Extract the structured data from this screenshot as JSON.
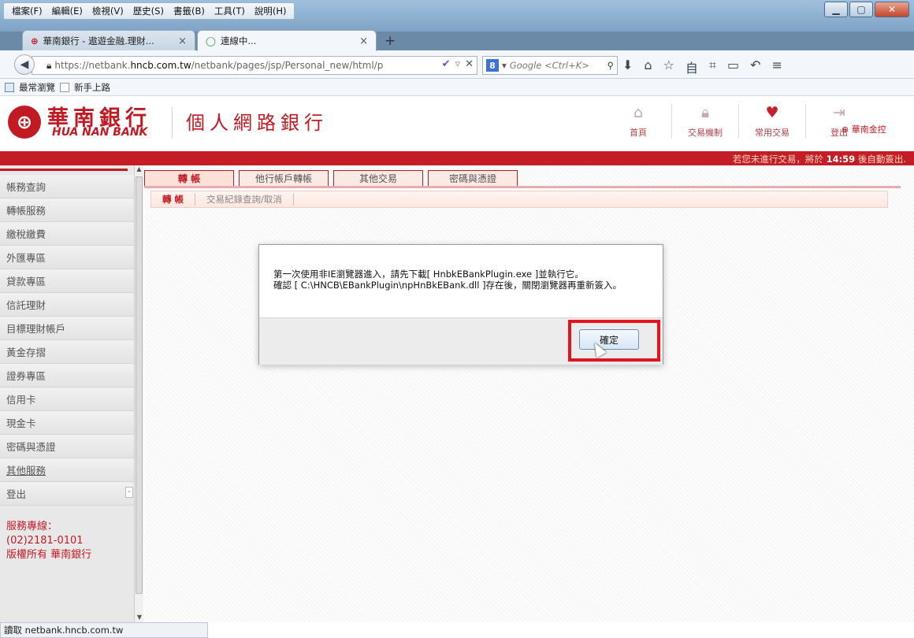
{
  "menu": [
    "檔案(F)",
    "編輯(E)",
    "檢視(V)",
    "歷史(S)",
    "書籤(B)",
    "工具(T)",
    "說明(H)"
  ],
  "tabs": [
    {
      "label": "華南銀行 - 遨遊金融.理財..."
    },
    {
      "label": "連線中..."
    }
  ],
  "url": {
    "prefix": "https://netbank.",
    "host": "hncb.com.tw",
    "rest": "/netbank/pages/jsp/Personal_new/html/p"
  },
  "search": {
    "placeholder": "Google <Ctrl+K>"
  },
  "bookmarks": [
    "最常瀏覽",
    "新手上路"
  ],
  "bank": {
    "logo_zh": "華南銀行",
    "logo_en": "HUA NAN BANK",
    "site_title": "個人網路銀行",
    "brand_small": "華南金控"
  },
  "topnav": [
    {
      "label": "首頁",
      "icon": "home-icon"
    },
    {
      "label": "交易機制",
      "icon": "lock-icon"
    },
    {
      "label": "常用交易",
      "icon": "heart-icon"
    },
    {
      "label": "登出",
      "icon": "logout-icon"
    }
  ],
  "notice": {
    "before": "若您未進行交易，將於 ",
    "time": "14:59",
    "after": " 後自動簽出."
  },
  "sidebar": {
    "items": [
      "帳務查詢",
      "轉帳服務",
      "繳稅繳費",
      "外匯專區",
      "貸款專區",
      "信託理財",
      "目標理財帳戶",
      "黃金存摺",
      "證券專區",
      "信用卡",
      "現金卡",
      "密碼與憑證",
      "其他服務",
      "登出"
    ],
    "footer": {
      "line1": "服務專線：",
      "line2": "(02)2181-0101",
      "line3": "版權所有 華南銀行"
    }
  },
  "content_tabs": [
    "轉 帳",
    "他行帳戶轉帳",
    "其他交易",
    "密碼與憑證"
  ],
  "sub_tabs": [
    "轉 帳",
    "交易紀錄查詢/取消"
  ],
  "dialog": {
    "line1": "第一次使用非IE瀏覽器進入，請先下載[ HnbkEBankPlugin.exe ]並執行它。",
    "line2": "確認 [ C:\\HNCB\\EBankPlugin\\npHnBkEBank.dll ]存在後，關閉瀏覽器再重新簽入。",
    "ok": "確定"
  },
  "status": "讀取 netbank.hncb.com.tw"
}
